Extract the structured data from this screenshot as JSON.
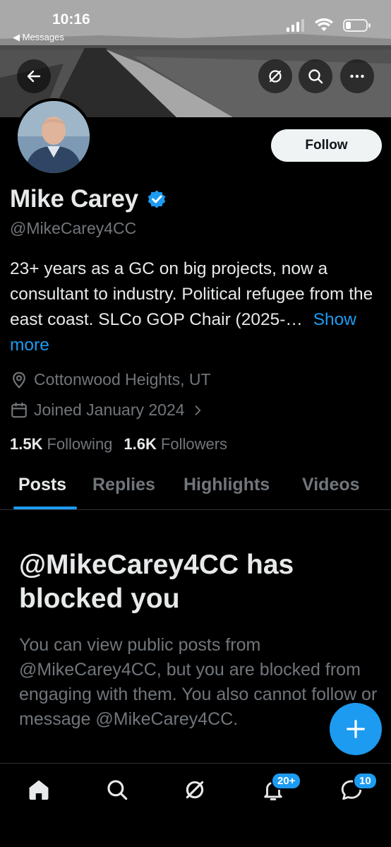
{
  "status_bar": {
    "time": "10:16",
    "back_app_label": "◀ Messages"
  },
  "profile": {
    "name": "Mike Carey",
    "handle": "@MikeCarey4CC",
    "verified": true,
    "bio": "23+ years as a GC on big projects, now a consultant to industry. Political refugee from the east coast. SLCo GOP Chair (2025-…",
    "show_more_label": "Show more",
    "location": "Cottonwood Heights, UT",
    "joined": "Joined January 2024",
    "following_count": "1.5K",
    "following_label": "Following",
    "followers_count": "1.6K",
    "followers_label": "Followers",
    "follow_button_label": "Follow"
  },
  "tabs": [
    {
      "label": "Posts",
      "active": true
    },
    {
      "label": "Replies",
      "active": false
    },
    {
      "label": "Highlights",
      "active": false
    },
    {
      "label": "Videos",
      "active": false
    }
  ],
  "blocked": {
    "title": "@MikeCarey4CC has blocked you",
    "description": "You can view public posts from @MikeCarey4CC, but you are blocked from engaging with them. You also cannot follow or message @MikeCarey4CC."
  },
  "bottom_nav": {
    "notifications_badge": "20+",
    "messages_badge": "10"
  },
  "colors": {
    "accent": "#1d9bf0",
    "background": "#000000",
    "primary_text": "#e7e9ea",
    "secondary_text": "#71767b"
  },
  "icons": [
    "back-arrow-icon",
    "grok-icon",
    "search-icon",
    "more-icon",
    "verified-badge-icon",
    "location-pin-icon",
    "calendar-icon",
    "chevron-right-icon",
    "compose-plus-icon",
    "home-icon",
    "notifications-bell-icon",
    "messages-icon"
  ]
}
